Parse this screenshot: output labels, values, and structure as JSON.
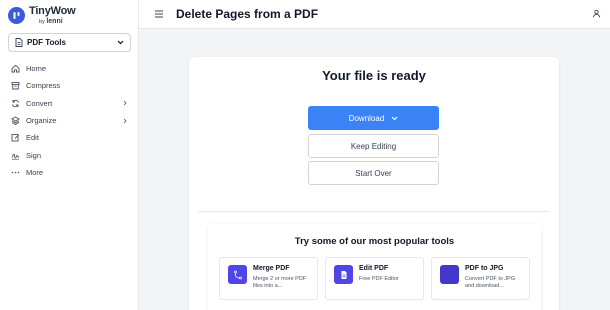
{
  "brand": {
    "name": "TinyWow",
    "by": "by",
    "org": "lenni",
    "color": "#3b5bdb"
  },
  "sidebar": {
    "tools_select": {
      "label": "PDF Tools",
      "icon": "document-icon"
    },
    "items": [
      {
        "label": "Home",
        "icon": "home-icon",
        "has_submenu": false
      },
      {
        "label": "Compress",
        "icon": "archive-icon",
        "has_submenu": false
      },
      {
        "label": "Convert",
        "icon": "refresh-icon",
        "has_submenu": true
      },
      {
        "label": "Organize",
        "icon": "layers-icon",
        "has_submenu": true
      },
      {
        "label": "Edit",
        "icon": "edit-icon",
        "has_submenu": false
      },
      {
        "label": "Sign",
        "icon": "signature-icon",
        "has_submenu": false
      },
      {
        "label": "More",
        "icon": "more-dots-icon",
        "has_submenu": false
      }
    ]
  },
  "header": {
    "title": "Delete Pages from a PDF"
  },
  "result": {
    "heading": "Your file is ready",
    "download_label": "Download",
    "keep_editing_label": "Keep Editing",
    "start_over_label": "Start Over",
    "accent": "#3b82f6"
  },
  "popular": {
    "title": "Try some of our most popular tools",
    "tools": [
      {
        "name": "Merge PDF",
        "desc": "Merge 2 or more PDF files into a...",
        "icon": "merge-icon"
      },
      {
        "name": "Edit PDF",
        "desc": "Free PDF Editor",
        "icon": "file-text-icon"
      },
      {
        "name": "PDF to JPG",
        "desc": "Convert PDF to JPG and download...",
        "icon": "image-icon"
      }
    ]
  }
}
